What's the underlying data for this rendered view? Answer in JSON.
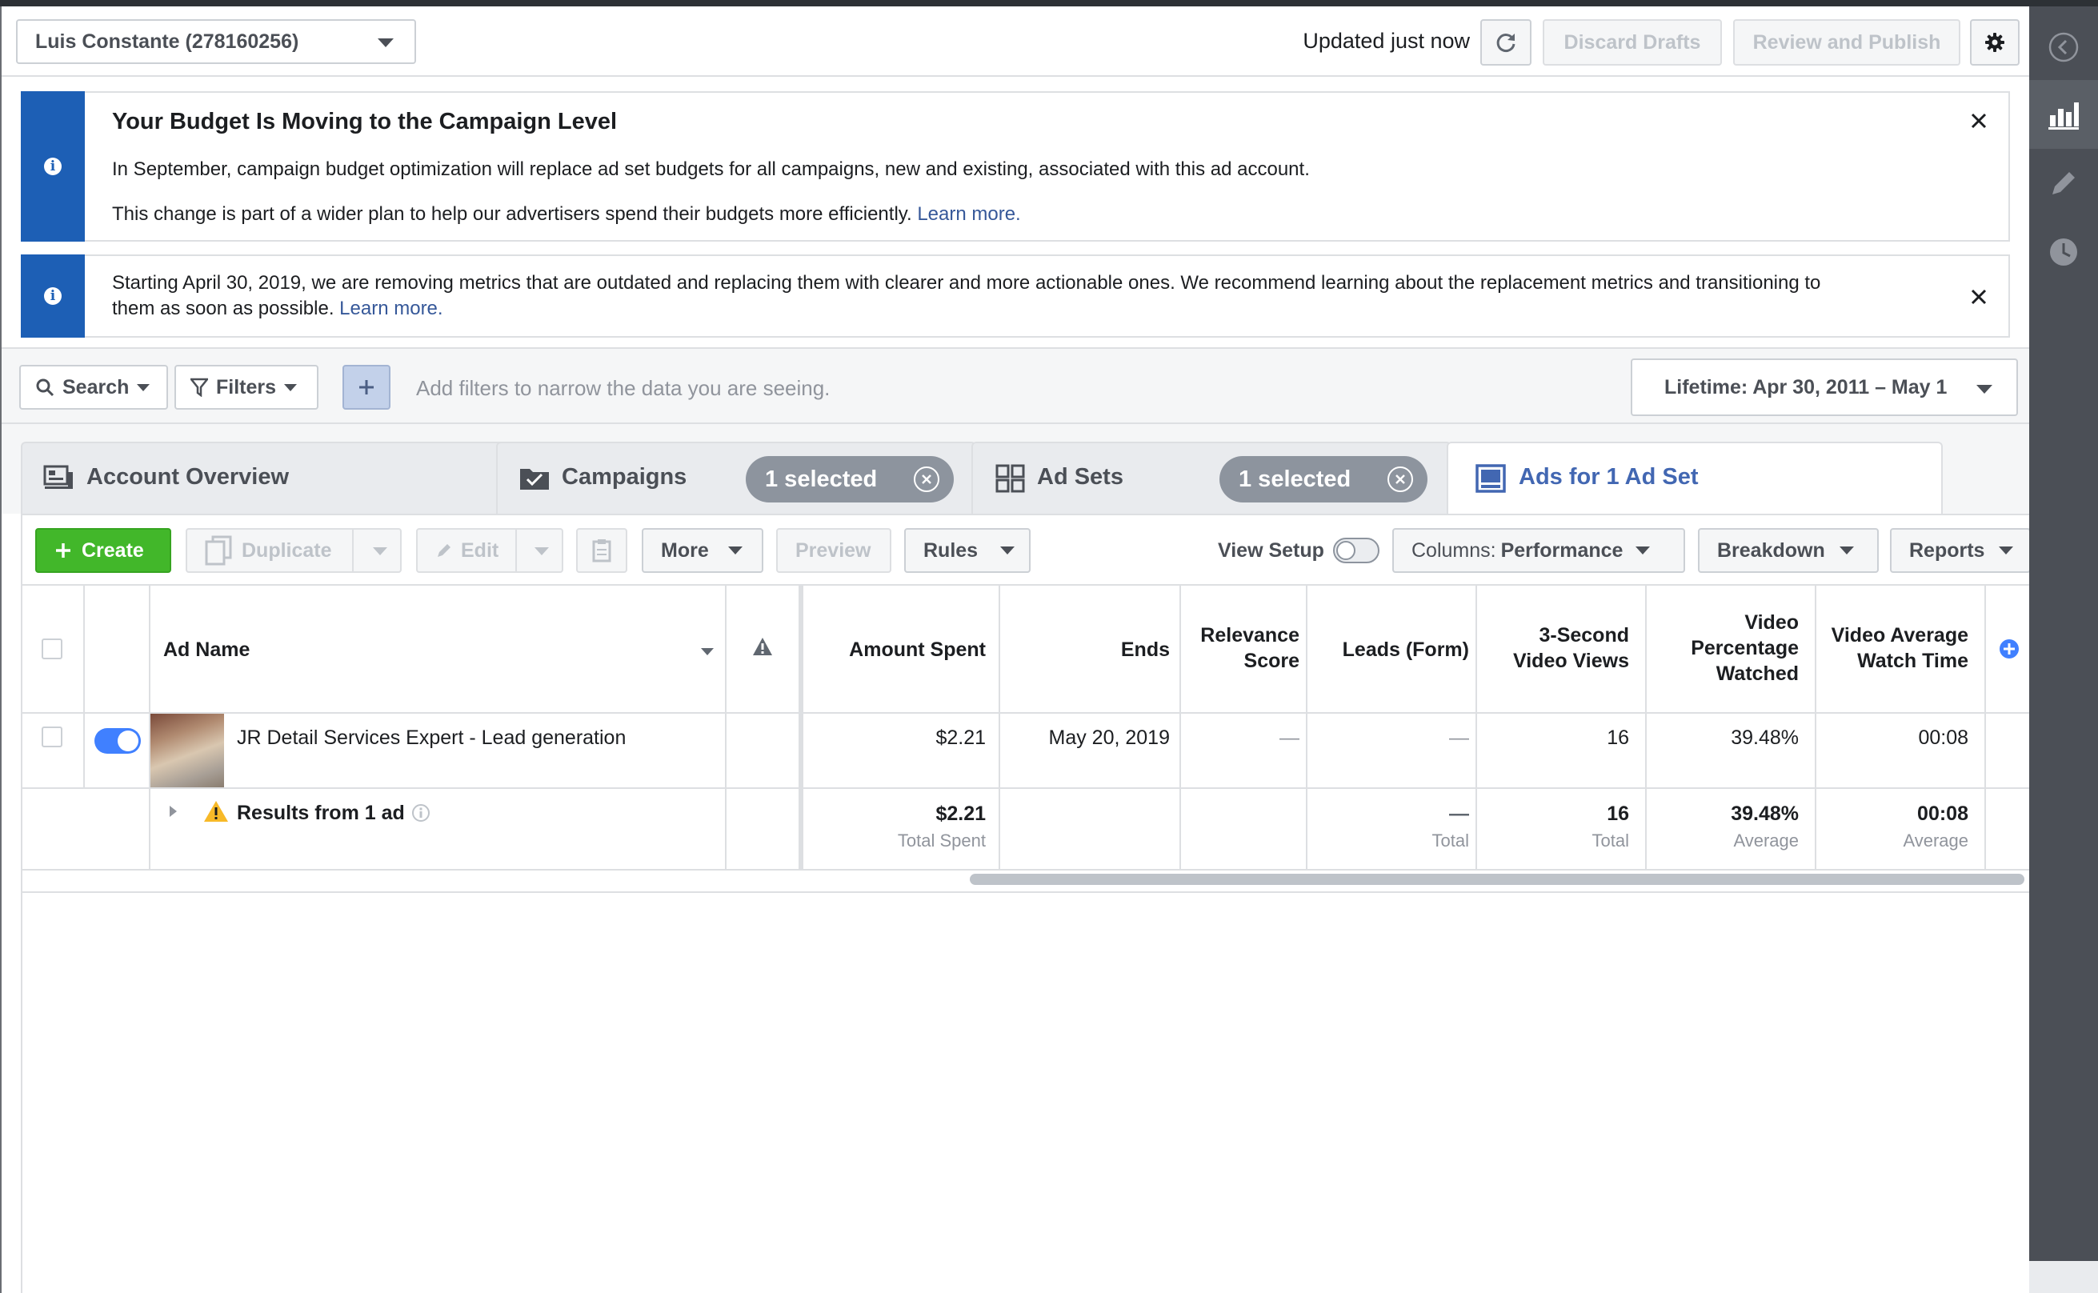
{
  "header": {
    "account": "Luis Constante (278160256)",
    "updated": "Updated just now",
    "discard_label": "Discard Drafts",
    "review_label": "Review and Publish"
  },
  "notices": [
    {
      "title": "Your Budget Is Moving to the Campaign Level",
      "line1": "In September, campaign budget optimization will replace ad set budgets for all campaigns, new and existing, associated with this ad account.",
      "line2": "This change is part of a wider plan to help our advertisers spend their budgets more efficiently.",
      "link": "Learn more."
    },
    {
      "line1": "Starting April 30, 2019, we are removing metrics that are outdated and replacing them with clearer and more actionable ones. We recommend learning about the replacement metrics and transitioning to",
      "line2": "them as soon as possible.",
      "link": "Learn more."
    }
  ],
  "filters": {
    "search_label": "Search",
    "filters_label": "Filters",
    "hint": "Add filters to narrow the data you are seeing.",
    "date_range": "Lifetime: Apr 30, 2011 – May 1"
  },
  "tabs": [
    {
      "label": "Account Overview"
    },
    {
      "label": "Campaigns",
      "selected": "1 selected"
    },
    {
      "label": "Ad Sets",
      "selected": "1 selected"
    },
    {
      "label": "Ads for 1 Ad Set"
    }
  ],
  "toolbar": {
    "create": "Create",
    "duplicate": "Duplicate",
    "edit": "Edit",
    "more": "More",
    "preview": "Preview",
    "rules": "Rules",
    "view_setup": "View Setup",
    "columns_prefix": "Columns:",
    "columns_value": "Performance",
    "breakdown": "Breakdown",
    "reports": "Reports"
  },
  "table": {
    "headers": {
      "ad_name": "Ad Name",
      "amount_spent": "Amount Spent",
      "ends": "Ends",
      "relevance_1": "Relevance",
      "relevance_2": "Score",
      "leads": "Leads (Form)",
      "views_1": "3-Second",
      "views_2": "Video Views",
      "pct_1": "Video",
      "pct_2": "Percentage",
      "pct_3": "Watched",
      "avg_1": "Video Average",
      "avg_2": "Watch Time"
    },
    "row": {
      "name": "JR Detail Services Expert - Lead generation",
      "amount_spent": "$2.21",
      "ends": "May 20, 2019",
      "relevance": "—",
      "leads": "—",
      "views": "16",
      "pct": "39.48%",
      "avg": "00:08"
    },
    "summary": {
      "label": "Results from 1 ad",
      "amount_spent": "$2.21",
      "amount_sub": "Total Spent",
      "leads": "—",
      "leads_sub": "Total",
      "views": "16",
      "views_sub": "Total",
      "pct": "39.48%",
      "pct_sub": "Average",
      "avg": "00:08",
      "avg_sub": "Average"
    }
  },
  "colors": {
    "brand_blue": "#4267b2",
    "notice_blue": "#1d5fb5",
    "create_green": "#42b72a",
    "toggle_blue": "#4080ff",
    "sidebar": "#4b4f56"
  },
  "icons": [
    "chevron-down-icon",
    "refresh-icon",
    "gear-icon",
    "info-icon",
    "close-icon",
    "search-icon",
    "filter-icon",
    "plus-icon",
    "account-overview-icon",
    "campaign-folder-icon",
    "ad-sets-grid-icon",
    "ads-icon",
    "duplicate-icon",
    "pencil-icon",
    "clipboard-icon",
    "warning-icon",
    "add-column-icon",
    "collapse-left-icon",
    "bar-chart-icon",
    "clock-icon"
  ]
}
